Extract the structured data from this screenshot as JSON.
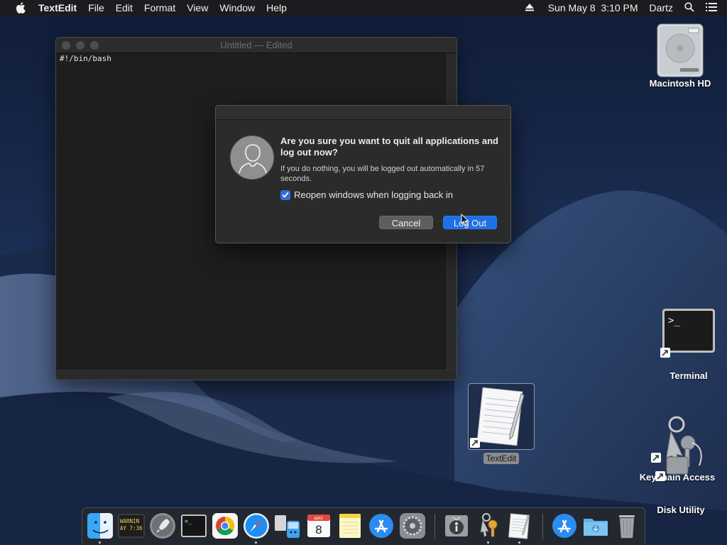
{
  "menubar": {
    "apple_icon": "apple-logo-icon",
    "app_name": "TextEdit",
    "menus": [
      "File",
      "Edit",
      "Format",
      "View",
      "Window",
      "Help"
    ],
    "eject_icon": "eject-icon",
    "clock": "Sun May 8  3:10 PM",
    "user": "Dartz",
    "search_icon": "spotlight-search-icon",
    "list_icon": "notification-center-icon"
  },
  "textedit": {
    "title": "Untitled — Edited",
    "content": "#!/bin/bash"
  },
  "dialog": {
    "title": "Are you sure you want to quit all applications and log out now?",
    "message": "If you do nothing, you will be logged out automatically in 57 seconds.",
    "checkbox_label": "Reopen windows when logging back in",
    "checkbox_checked": true,
    "cancel_label": "Cancel",
    "logout_label": "Log Out",
    "accent_color": "#1f6fe5"
  },
  "desktop": {
    "icons": [
      {
        "label": "Macintosh HD",
        "icon": "hard-drive-icon"
      },
      {
        "label": "Terminal",
        "icon": "terminal-icon"
      },
      {
        "label": "TextEdit",
        "icon": "textedit-document-icon"
      },
      {
        "label": "Keychain Access",
        "icon": "keychain-icon"
      },
      {
        "label": "Disk Utility",
        "icon": "disk-utility-icon"
      }
    ]
  },
  "dock": {
    "items": [
      {
        "name": "Finder",
        "icon": "finder-icon",
        "running": true
      },
      {
        "name": "Console",
        "icon": "console-icon",
        "running": false,
        "text": "WARNIN\nAY 7:36"
      },
      {
        "name": "Launchpad",
        "icon": "launchpad-icon",
        "running": false
      },
      {
        "name": "Terminal",
        "icon": "terminal-icon",
        "running": false
      },
      {
        "name": "Chrome",
        "icon": "chrome-icon",
        "running": false
      },
      {
        "name": "Safari",
        "icon": "safari-icon",
        "running": true
      },
      {
        "name": "Migration Assistant",
        "icon": "migration-assistant-icon",
        "running": false
      },
      {
        "name": "Calendar",
        "icon": "calendar-icon",
        "running": false,
        "month": "MAY",
        "day": "8"
      },
      {
        "name": "Notes",
        "icon": "notes-icon",
        "running": false
      },
      {
        "name": "App Store",
        "icon": "app-store-icon",
        "running": false
      },
      {
        "name": "System Preferences",
        "icon": "system-preferences-icon",
        "running": false
      },
      {
        "name": "VoiceOver Utility",
        "icon": "voiceover-utility-icon",
        "running": false
      },
      {
        "name": "Keychain Access",
        "icon": "keychain-icon",
        "running": true
      },
      {
        "name": "TextEdit",
        "icon": "textedit-icon",
        "running": true
      },
      {
        "name": "App Store Folder",
        "icon": "app-store-icon",
        "running": false
      },
      {
        "name": "Downloads",
        "icon": "downloads-folder-icon",
        "running": false
      },
      {
        "name": "Trash",
        "icon": "trash-icon",
        "running": false
      }
    ]
  }
}
